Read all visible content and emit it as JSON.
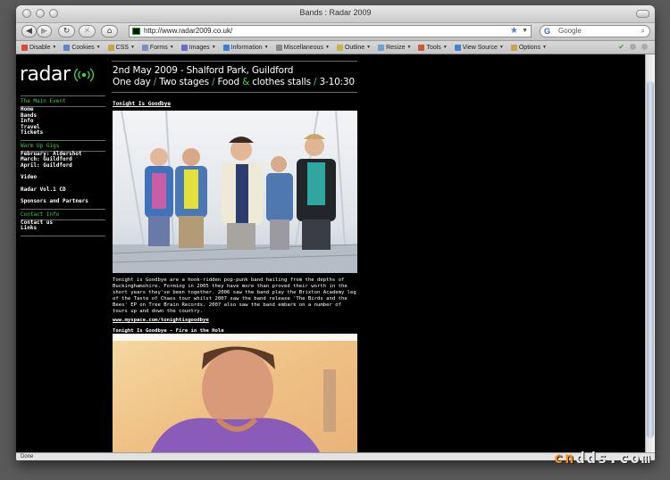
{
  "browser": {
    "window_title": "Bands : Radar 2009",
    "url": "http://www.radar2009.co.uk/",
    "search_placeholder": "Google",
    "status": "Done",
    "toolbar": [
      "Disable",
      "Cookies",
      "CSS",
      "Forms",
      "Images",
      "Information",
      "Miscellaneous",
      "Outline",
      "Resize",
      "Tools",
      "View Source",
      "Options"
    ],
    "toolbar_icons": [
      "disable-icon",
      "cookie-icon",
      "css-icon",
      "forms-icon",
      "images-icon",
      "information-icon",
      "miscellaneous-icon",
      "outline-icon",
      "resize-icon",
      "tools-icon",
      "view-source-icon",
      "options-icon"
    ],
    "toolbar_icon_colors": [
      "#d94a3a",
      "#5b87c9",
      "#c9a24a",
      "#7a8fc2",
      "#6b6bc9",
      "#3a7fd1",
      "#8a8a8a",
      "#c9b24a",
      "#6aa2d1",
      "#c95a3a",
      "#4a7fd1",
      "#c9a24a"
    ]
  },
  "site": {
    "logo": "radar",
    "header": {
      "line1": "2nd May 2009 - Shalford Park, Guildford",
      "line2_parts": [
        "One day",
        "Two stages",
        "Food",
        "clothes stalls",
        "3-10:30"
      ],
      "line2_separators": [
        "/",
        "/",
        "&",
        "/"
      ]
    },
    "sidebar": {
      "main_event_heading": "The Main Event",
      "main_event_links": [
        "Home",
        "Bands",
        "Info",
        "Travel",
        "Tickets"
      ],
      "warm_up_heading": "Warm Up Gigs",
      "warm_up_links": [
        "February: Aldershot",
        "March: Guildford",
        "April: Guildford"
      ],
      "misc_links": [
        "Video",
        "Radar Vol.1 CD",
        "Sponsors and Partners"
      ],
      "contact_heading": "Contact Info",
      "contact_links": [
        "Contact us",
        "Links"
      ]
    },
    "band": {
      "name": "Tonight Is Goodbye",
      "bio": "Tonight is Goodbye are a hook-ridden pop-punk band hailing from the depths of Buckinghamshire. Forming in 2005 they have more than proved their worth in the short years they've been together. 2006 saw the band play the Brixton Academy leg of the Taste of Chaos tour whilst 2007 saw the band release 'The Birds and the Bees' EP on Tree Brain Records. 2007 also saw the band embark on a number of tours up and down the country.",
      "link": "www.myspace.com/tonightisgoodbye",
      "video_title": "Tonight Is Goodbye - Fire in the Hole"
    },
    "accent_color": "#3fd04a"
  },
  "watermark": {
    "part1": "cn",
    "part2": "dds.com"
  }
}
